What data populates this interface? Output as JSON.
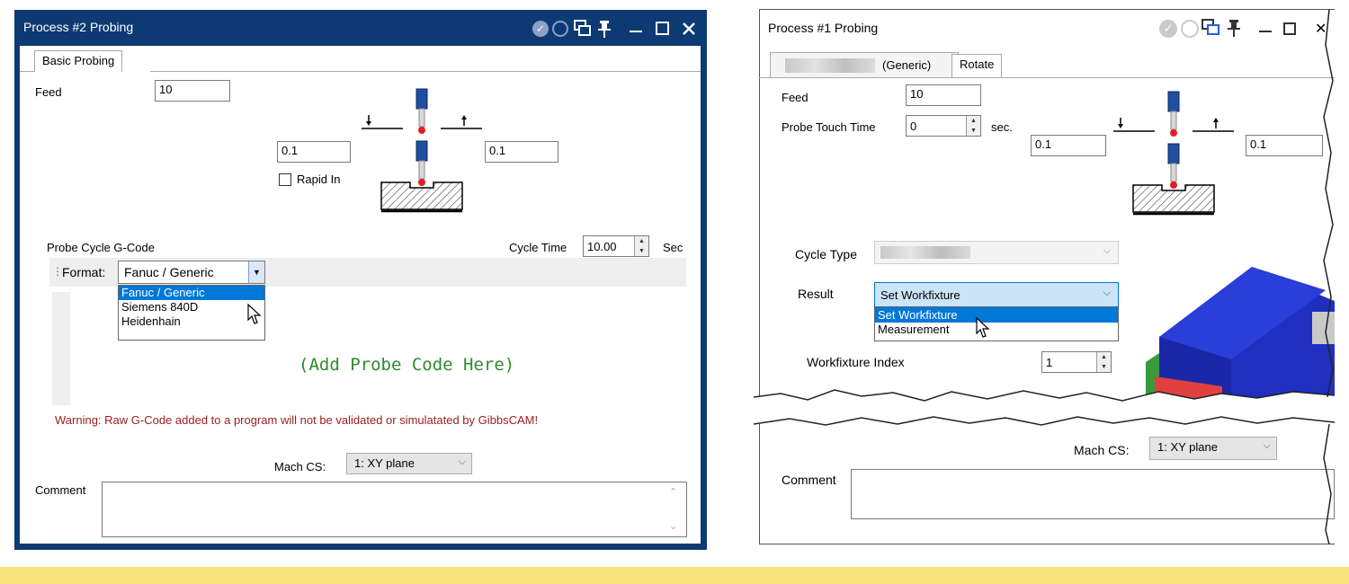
{
  "left_window": {
    "title": "Process #2 Probing",
    "tab": "Basic Probing",
    "feed_label": "Feed",
    "feed_value": "10",
    "left_offset_value": "0.1",
    "right_offset_value": "0.1",
    "rapid_in_label": "Rapid In",
    "rapid_in_checked": false,
    "probe_cycle_label": "Probe Cycle G-Code",
    "cycle_time_label": "Cycle Time",
    "cycle_time_value": "10.00",
    "cycle_time_unit": "Sec",
    "format_label": "Format:",
    "format_selected": "Fanuc / Generic",
    "format_options": [
      "Fanuc / Generic",
      "Siemens 840D",
      "Heidenhain"
    ],
    "code_placeholder": "(Add Probe Code Here)",
    "warning": "Warning: Raw G-Code added to a program will not be validated or simulatated by GibbsCAM!",
    "mach_cs_label": "Mach CS:",
    "mach_cs_value": "1: XY plane",
    "comment_label": "Comment",
    "comment_value": ""
  },
  "right_window": {
    "title": "Process #1 Probing",
    "tabs": [
      "(Generic)",
      "Rotate"
    ],
    "feed_label": "Feed",
    "feed_value": "10",
    "probe_touch_label": "Probe Touch Time",
    "probe_touch_value": "0",
    "probe_touch_unit": "sec.",
    "left_offset_value": "0.1",
    "right_offset_value": "0.1",
    "cycle_type_label": "Cycle Type",
    "result_label": "Result",
    "result_selected": "Set Workfixture",
    "result_options": [
      "Set Workfixture",
      "Measurement"
    ],
    "workfixture_index_label": "Workfixture Index",
    "workfixture_index_value": "1",
    "mach_cs_label": "Mach CS:",
    "mach_cs_value": "1: XY plane",
    "comment_label": "Comment",
    "comment_value": ""
  },
  "titlebar_icons": [
    "check-icon",
    "refresh-icon",
    "windows-icon",
    "pin-icon",
    "minimize-icon",
    "maximize-icon",
    "close-icon"
  ],
  "colors": {
    "window_frame": "#0d3a72",
    "selection": "#0078d7",
    "warning_text": "#9b1c1c",
    "code_placeholder": "#2e8b2e",
    "banner": "#f7e27a",
    "probe_blue": "#1f4fa0",
    "probe_tip": "#e02020",
    "model_blue": "#1f2fbf"
  }
}
